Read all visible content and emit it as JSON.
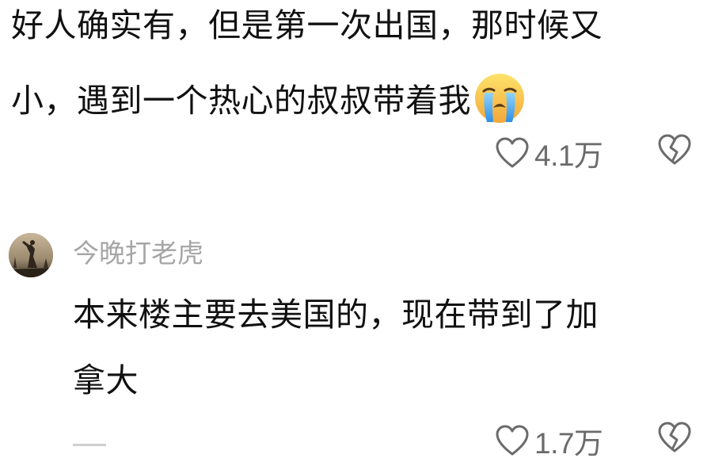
{
  "comments": [
    {
      "text_line1": "好人确实有，但是第一次出国，那时候又",
      "text_line2": "小，遇到一个热心的叔叔带着我",
      "emoji": "loudly-crying-face-emoji",
      "likes": "4.1万"
    },
    {
      "username": "今晚打老虎",
      "text_line1": "本来楼主要去美国的，现在带到了加",
      "text_line2": "拿大",
      "likes": "1.7万"
    }
  ],
  "icons": {
    "like": "heart-outline-icon",
    "dislike": "broken-heart-icon",
    "emoji": "loudly-crying-face"
  },
  "colors": {
    "text": "#111111",
    "meta": "#6b6b6b",
    "username": "#a6a6a6",
    "emoji_face": "#f7c33e"
  }
}
